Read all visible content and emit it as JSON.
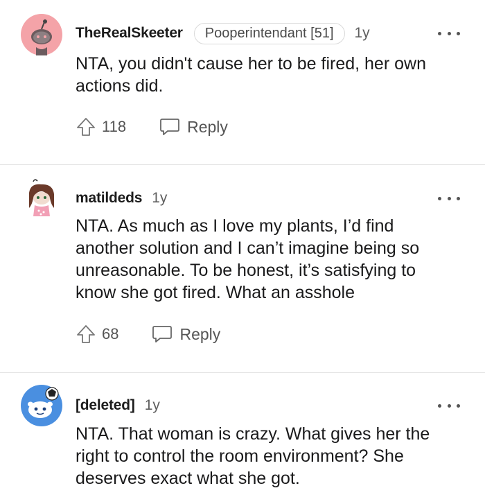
{
  "comments": [
    {
      "username": "TheRealSkeeter",
      "flair": "Pooperintendant [51]",
      "age": "1y",
      "lines": [
        "NTA, you didn't cause her to be fired, her own",
        "actions did."
      ],
      "votes": "118",
      "reply_label": "Reply"
    },
    {
      "username": "matildeds",
      "age": "1y",
      "lines": [
        "NTA. As much as I love my plants, I’d find",
        "another solution and I can’t imagine being so",
        "unreasonable. To be honest, it’s satisfying to",
        "know she got fired. What an asshole"
      ],
      "votes": "68",
      "reply_label": "Reply"
    },
    {
      "username": "[deleted]",
      "age": "1y",
      "lines": [
        "NTA. That woman is crazy. What gives her the",
        "right to control the room environment? She",
        "deserves exact what she got."
      ]
    }
  ],
  "icons": {
    "upvote": "upvote-arrow-icon",
    "reply": "speech-bubble-icon",
    "more": "ellipsis-icon"
  },
  "colors": {
    "avatar1_bg": "#f4a3a8",
    "avatar3_bg": "#4a8fe0",
    "divider": "#e4e4e4"
  }
}
